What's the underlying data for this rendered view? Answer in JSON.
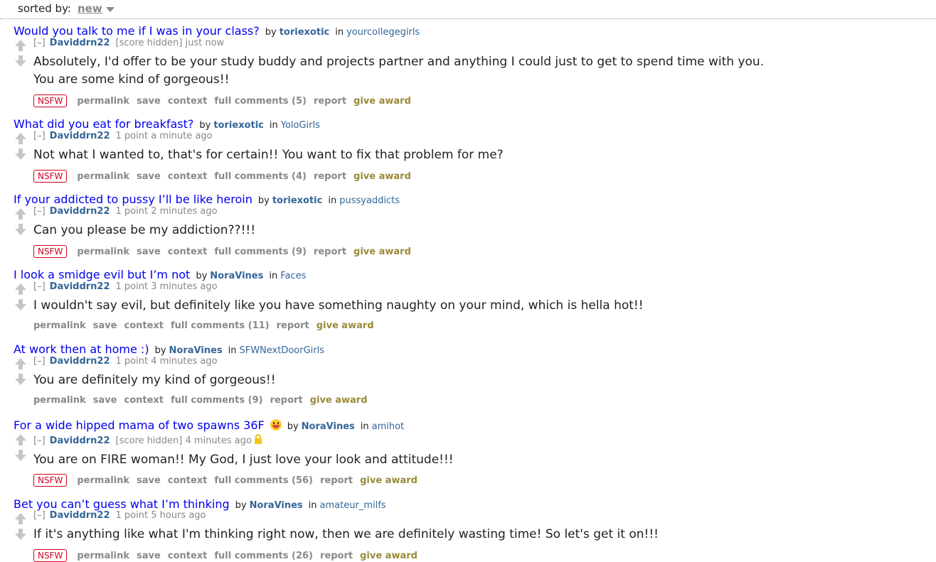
{
  "sort": {
    "label": "sorted by:",
    "value": "new"
  },
  "entries": [
    {
      "title": "Would you talk to me if I was in your class?",
      "by": "by",
      "author": "toriexotic",
      "in": "in",
      "subreddit": "yourcollegegirls",
      "expand": "[–]",
      "comment_author": "Daviddrn22",
      "score": "[score hidden]",
      "time": "just now",
      "body": "Absolutely, I'd offer to be your study buddy and projects partner and anything I could just to get to spend time with you. You are some kind of gorgeous!!",
      "nsfw": "NSFW",
      "permalink": "permalink",
      "save": "save",
      "context": "context",
      "full_comments": "full comments (5)",
      "report": "report",
      "give_award": "give award"
    },
    {
      "title": "What did you eat for breakfast?",
      "by": "by",
      "author": "toriexotic",
      "in": "in",
      "subreddit": "YoloGirls",
      "expand": "[–]",
      "comment_author": "Daviddrn22",
      "score": "1 point",
      "time": "a minute ago",
      "body": "Not what I wanted to, that's for certain!! You want to fix that problem for me?",
      "nsfw": "NSFW",
      "permalink": "permalink",
      "save": "save",
      "context": "context",
      "full_comments": "full comments (4)",
      "report": "report",
      "give_award": "give award"
    },
    {
      "title": "If your addicted to pussy I’ll be like heroin",
      "by": "by",
      "author": "toriexotic",
      "in": "in",
      "subreddit": "pussyaddicts",
      "expand": "[–]",
      "comment_author": "Daviddrn22",
      "score": "1 point",
      "time": "2 minutes ago",
      "body": "Can you please be my addiction??!!!",
      "nsfw": "NSFW",
      "permalink": "permalink",
      "save": "save",
      "context": "context",
      "full_comments": "full comments (9)",
      "report": "report",
      "give_award": "give award"
    },
    {
      "title": "I look a smidge evil but I’m not",
      "by": "by",
      "author": "NoraVines",
      "in": "in",
      "subreddit": "Faces",
      "expand": "[–]",
      "comment_author": "Daviddrn22",
      "score": "1 point",
      "time": "3 minutes ago",
      "body": "I wouldn't say evil, but definitely like you have something naughty on your mind, which is hella hot!!",
      "permalink": "permalink",
      "save": "save",
      "context": "context",
      "full_comments": "full comments (11)",
      "report": "report",
      "give_award": "give award"
    },
    {
      "title": "At work then at home :)",
      "by": "by",
      "author": "NoraVines",
      "in": "in",
      "subreddit": "SFWNextDoorGirls",
      "expand": "[–]",
      "comment_author": "Daviddrn22",
      "score": "1 point",
      "time": "4 minutes ago",
      "body": "You are definitely my kind of gorgeous!!",
      "permalink": "permalink",
      "save": "save",
      "context": "context",
      "full_comments": "full comments (9)",
      "report": "report",
      "give_award": "give award"
    },
    {
      "title": "For a wide hipped mama of two spawns 36F",
      "by": "by",
      "author": "NoraVines",
      "in": "in",
      "subreddit": "amihot",
      "expand": "[–]",
      "comment_author": "Daviddrn22",
      "score": "[score hidden]",
      "time": "4 minutes ago",
      "body": "You are on FIRE woman!! My God, I just love your look and attitude!!!",
      "nsfw": "NSFW",
      "permalink": "permalink",
      "save": "save",
      "context": "context",
      "full_comments": "full comments (56)",
      "report": "report",
      "give_award": "give award"
    },
    {
      "title": "Bet you can’t guess what I’m thinking",
      "by": "by",
      "author": "NoraVines",
      "in": "in",
      "subreddit": "amateur_milfs",
      "expand": "[–]",
      "comment_author": "Daviddrn22",
      "score": "1 point",
      "time": "5 hours ago",
      "body": "If it's anything like what I'm thinking right now, then we are definitely wasting time! So let's get it on!!!",
      "nsfw": "NSFW",
      "permalink": "permalink",
      "save": "save",
      "context": "context",
      "full_comments": "full comments (26)",
      "report": "report",
      "give_award": "give award"
    }
  ]
}
